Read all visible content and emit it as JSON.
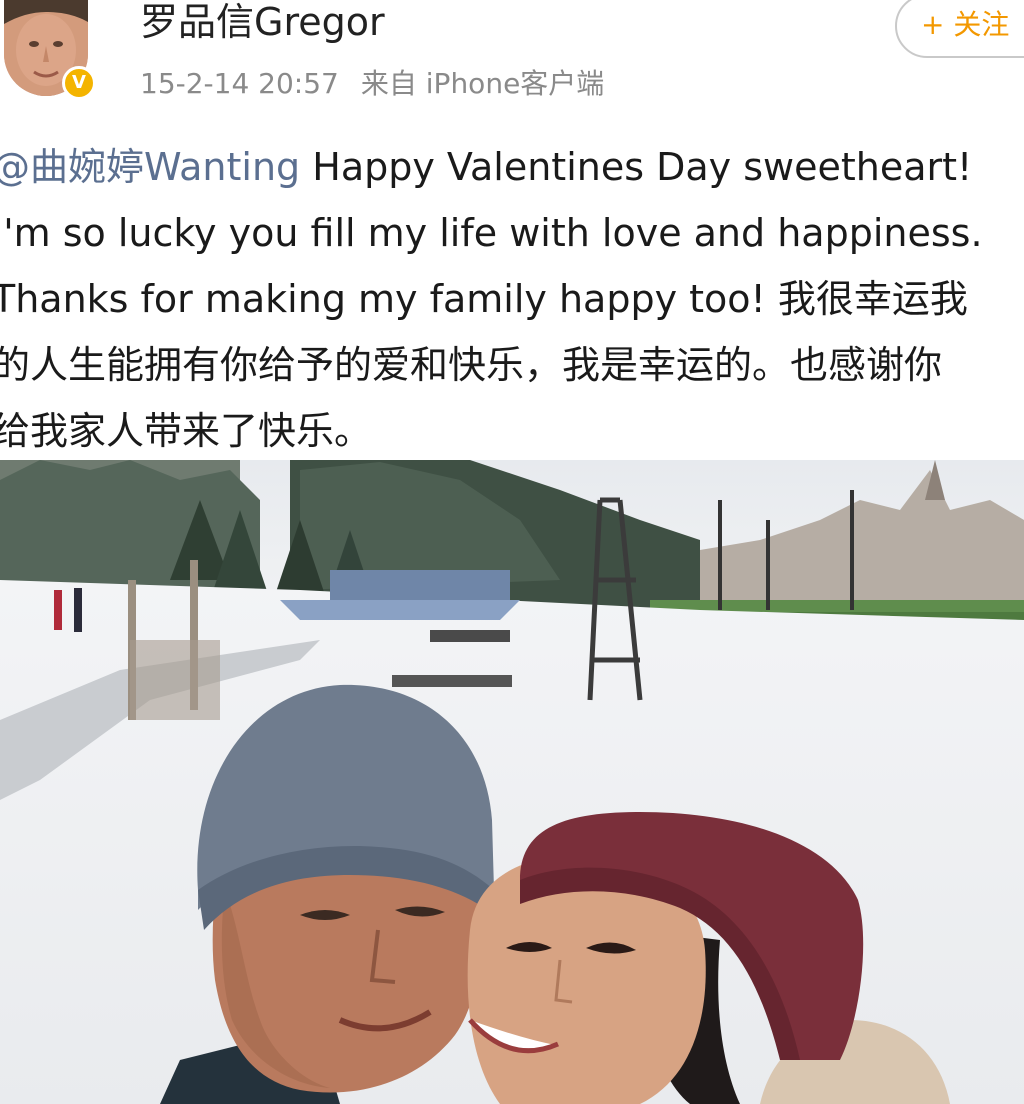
{
  "post": {
    "author": {
      "name": "罗品信Gregor",
      "verified": true,
      "verified_mark": "V"
    },
    "timestamp": "15-2-14 20:57",
    "source": "来自 iPhone客户端",
    "follow_label": "+ 关注",
    "text": {
      "mention": "@曲婉婷Wanting",
      "line1_rest": " Happy Valentines Day sweetheart!",
      "line2": "I'm so lucky you fill my life with love and happiness.",
      "line3": "Thanks for making my family happy too! 我很幸运我",
      "line4": "的人生能拥有你给予的爱和快乐，我是幸运的。也感谢你",
      "line5": "给我家人带来了快乐。"
    },
    "photo": {
      "icon": "photo-image"
    }
  },
  "colors": {
    "text": "#1a1a1a",
    "meta": "#8a8a8a",
    "mention": "#5b6f90",
    "follow": "#f39800",
    "badge": "#f4b400"
  }
}
